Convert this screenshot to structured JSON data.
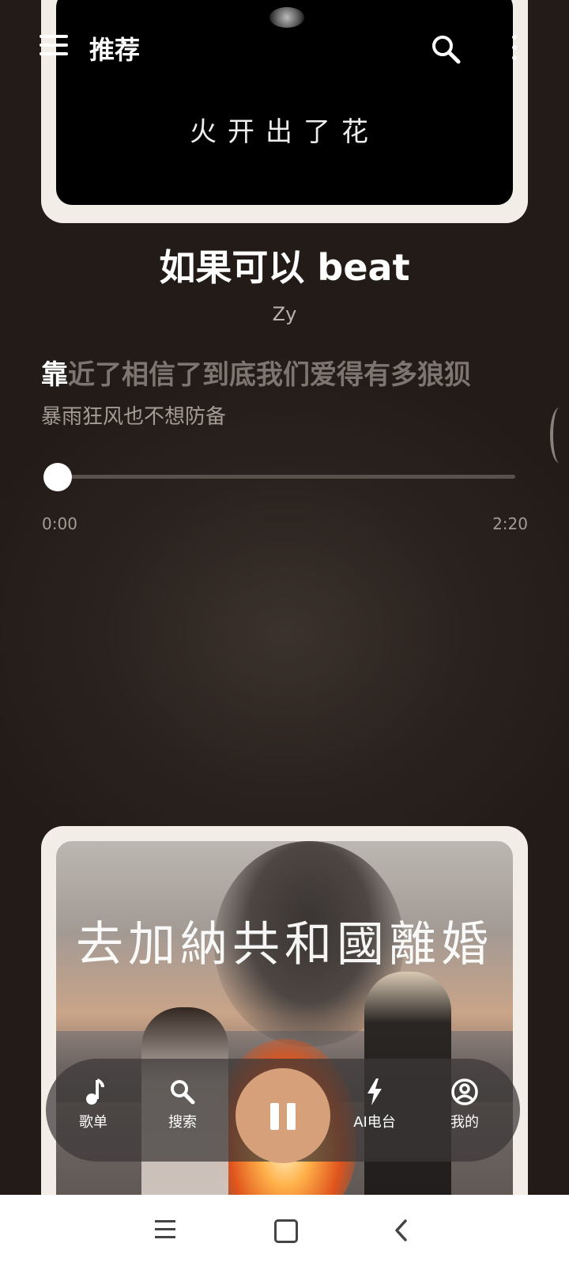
{
  "header": {
    "title": "推荐",
    "menu_icon": "menu-icon",
    "search_icon": "search-icon",
    "more_icon": "more-vert-icon"
  },
  "album_top": {
    "art_text": "火开出了花"
  },
  "song": {
    "title": "如果可以 beat",
    "artist": "Zy"
  },
  "lyrics": {
    "current_highlight": "靠",
    "current_rest": "近了相信了到底我们爱得有多狼狈",
    "next": "暴雨狂风也不想防备"
  },
  "progress": {
    "current_time": "0:00",
    "total_time": "2:20",
    "fraction": 0.0
  },
  "album_bottom": {
    "art_text": "去加納共和國離婚"
  },
  "bottom_nav": {
    "items": [
      {
        "label": "歌单",
        "icon": "music-note-icon"
      },
      {
        "label": "搜索",
        "icon": "search-icon"
      },
      {
        "label": "AI电台",
        "icon": "lightning-icon"
      },
      {
        "label": "我的",
        "icon": "account-circle-icon"
      }
    ],
    "play_state": "playing",
    "accent_color": "#d6a07a"
  },
  "system_nav": {
    "icons": [
      "menu-icon",
      "home-icon",
      "back-icon"
    ]
  }
}
